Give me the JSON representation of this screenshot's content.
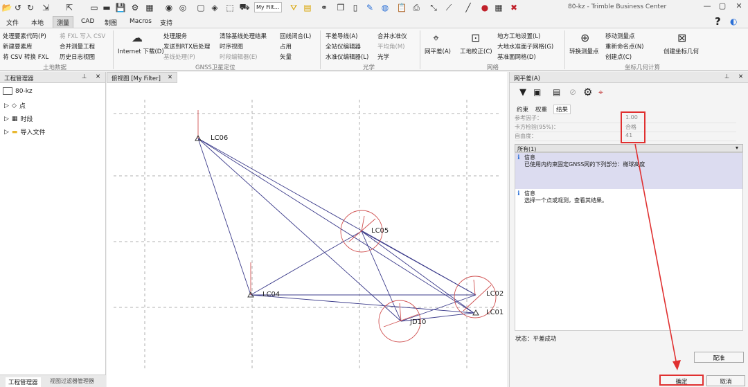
{
  "window": {
    "title": "80-kz - Trimble Business Center"
  },
  "toolbar": {
    "filter_value": "My Filt..."
  },
  "menu": {
    "items": [
      "文件",
      "本地",
      "测量",
      "CAD",
      "制图",
      "Macros",
      "支持"
    ],
    "active_index": 2
  },
  "ribbon": {
    "land_data": {
      "items": [
        "处理要素代码(P)",
        "将 FXL 写入 CSV",
        "新建要素库",
        "合并测量工程",
        "将 CSV 转换 FXL",
        "历史日志视图"
      ],
      "group": "土地数据"
    },
    "gnss": {
      "internet": "Internet 下载(D)",
      "items": [
        "处理服务",
        "清除基线处理结果",
        "回线闭合(L)",
        "发送到RTX后处理",
        "时序视图",
        "占用",
        "基线处理(P)",
        "时段编辑器(E)",
        "矢量"
      ],
      "group": "GNSS卫星定位"
    },
    "optics": {
      "items": [
        "平差导线(A)",
        "合并水准仪",
        "全站仪编辑器",
        "平均角(M)",
        "水准仪编辑器(L)",
        "光学"
      ],
      "group": "光学"
    },
    "network": {
      "items": [
        "网平差(A)",
        "工地校正(C)",
        "地方工地设置(L)",
        "大地水准面子网格(G)",
        "基准面网格(D)"
      ],
      "group": "网络"
    },
    "cogo": {
      "items": [
        "转换测量点",
        "移动测量点",
        "重新命名点(N)",
        "创建点(C)",
        "创建坐标几何"
      ],
      "group": "坐标几何计算"
    }
  },
  "left_panel": {
    "title": "工程管理器",
    "tree": [
      "80-kz",
      "点",
      "时段",
      "导入文件"
    ],
    "bottom_tabs": [
      "工程管理器",
      "视图过滤器管理器"
    ]
  },
  "plan_view": {
    "tab": "俯视图 [My Filter]",
    "points": [
      {
        "name": "LC06"
      },
      {
        "name": "LC05"
      },
      {
        "name": "LC04"
      },
      {
        "name": "LC02"
      },
      {
        "name": "LC01"
      },
      {
        "name": "JD10"
      }
    ]
  },
  "adjust_panel": {
    "title": "网平差(A)",
    "tabs": [
      "约束",
      "权重",
      "结果"
    ],
    "active_tab": "结果",
    "rows": [
      {
        "label": "参考因子：",
        "value": "1.00"
      },
      {
        "label": "卡方检验(95%)：",
        "value": "合格"
      },
      {
        "label": "自由度：",
        "value": "41"
      }
    ],
    "filter": "所有(1)",
    "messages": [
      {
        "title": "信息",
        "text": "已使用内约束固定GNSS网的下列部分：椭球高度"
      },
      {
        "title": "信息",
        "text": "选择一个点或观测，查看其结果。"
      }
    ],
    "status": "状态：平差成功",
    "options_button": "配准",
    "ok_button": "确定",
    "cancel_button": "取消"
  },
  "colors": {
    "accent_red": "#e03030",
    "network_line": "#3a3a8a"
  }
}
